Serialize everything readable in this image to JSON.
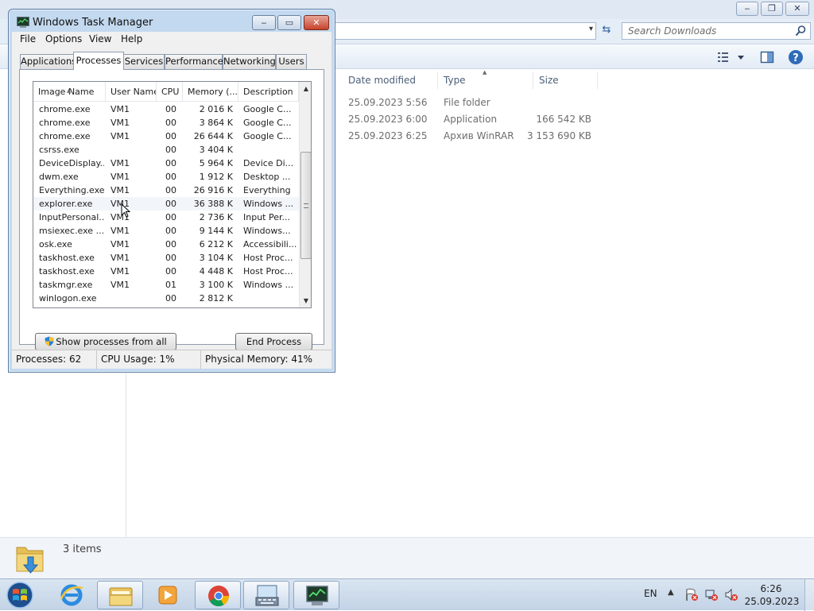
{
  "explorer": {
    "search_placeholder": "Search Downloads",
    "columns": {
      "date_modified": "Date modified",
      "type": "Type",
      "size": "Size"
    },
    "rows": [
      {
        "date": "25.09.2023 5:56",
        "type": "File folder",
        "size": ""
      },
      {
        "date": "25.09.2023 6:00",
        "type": "Application",
        "size": "166 542 KB"
      },
      {
        "date": "25.09.2023 6:25",
        "type": "Архив WinRAR",
        "size": "3 153 690 KB"
      }
    ],
    "status": "3 items",
    "window_controls": {
      "minimize": "‒",
      "maximize": "❐",
      "close": "✕"
    },
    "refresh_glyph": "⇆",
    "dropdown_glyph": "▾"
  },
  "task_manager": {
    "title": "Windows Task Manager",
    "window_controls": {
      "minimize": "‒",
      "maximize": "▭",
      "close": "✕"
    },
    "menu": [
      "File",
      "Options",
      "View",
      "Help"
    ],
    "tabs": [
      "Applications",
      "Processes",
      "Services",
      "Performance",
      "Networking",
      "Users"
    ],
    "active_tab": "Processes",
    "columns": [
      "Image Name",
      "User Name",
      "CPU",
      "Memory (...",
      "Description"
    ],
    "rows": [
      {
        "image": "chrome.exe",
        "user": "VM1",
        "cpu": "00",
        "memory": "2 016 K",
        "description": "Google C..."
      },
      {
        "image": "chrome.exe",
        "user": "VM1",
        "cpu": "00",
        "memory": "3 864 K",
        "description": "Google C..."
      },
      {
        "image": "chrome.exe",
        "user": "VM1",
        "cpu": "00",
        "memory": "26 644 K",
        "description": "Google C..."
      },
      {
        "image": "csrss.exe",
        "user": "",
        "cpu": "00",
        "memory": "3 404 K",
        "description": ""
      },
      {
        "image": "DeviceDisplay...",
        "user": "VM1",
        "cpu": "00",
        "memory": "5 964 K",
        "description": "Device Di..."
      },
      {
        "image": "dwm.exe",
        "user": "VM1",
        "cpu": "00",
        "memory": "1 912 K",
        "description": "Desktop ..."
      },
      {
        "image": "Everything.exe",
        "user": "VM1",
        "cpu": "00",
        "memory": "26 916 K",
        "description": "Everything"
      },
      {
        "image": "explorer.exe",
        "user": "VM1",
        "cpu": "00",
        "memory": "36 388 K",
        "description": "Windows ..."
      },
      {
        "image": "InputPersonal...",
        "user": "VM1",
        "cpu": "00",
        "memory": "2 736 K",
        "description": "Input Per..."
      },
      {
        "image": "msiexec.exe ...",
        "user": "VM1",
        "cpu": "00",
        "memory": "9 144 K",
        "description": "Windows..."
      },
      {
        "image": "osk.exe",
        "user": "VM1",
        "cpu": "00",
        "memory": "6 212 K",
        "description": "Accessibili..."
      },
      {
        "image": "taskhost.exe",
        "user": "VM1",
        "cpu": "00",
        "memory": "3 104 K",
        "description": "Host Proc..."
      },
      {
        "image": "taskhost.exe",
        "user": "VM1",
        "cpu": "00",
        "memory": "4 448 K",
        "description": "Host Proc..."
      },
      {
        "image": "taskmgr.exe",
        "user": "VM1",
        "cpu": "01",
        "memory": "3 100 K",
        "description": "Windows ..."
      },
      {
        "image": "winlogon.exe",
        "user": "",
        "cpu": "00",
        "memory": "2 812 K",
        "description": ""
      }
    ],
    "hovered_row": "explorer.exe",
    "scroll_position": 0.62,
    "buttons": {
      "show_all": "Show processes from all users",
      "end_process": "End Process"
    },
    "status": {
      "processes": "Processes: 62",
      "cpu": "CPU Usage: 1%",
      "memory": "Physical Memory: 41%"
    },
    "scroll_glyphs": {
      "up": "▲",
      "down": "▼"
    }
  },
  "taskbar": {
    "apps": [
      {
        "name": "internet-explorer-icon",
        "open": false
      },
      {
        "name": "file-explorer-icon",
        "open": true
      },
      {
        "name": "media-player-icon",
        "open": false
      },
      {
        "name": "chrome-icon",
        "open": true
      },
      {
        "name": "on-screen-keyboard-icon",
        "open": true
      },
      {
        "name": "task-manager-icon",
        "open": true
      }
    ],
    "language": "EN",
    "tray_arrow": "▲",
    "time": "6:26",
    "date": "25.09.2023"
  },
  "colors": {
    "accent": "#2a5d9c",
    "titlebar": "#c3d9ef",
    "close_red": "#c7412b"
  }
}
